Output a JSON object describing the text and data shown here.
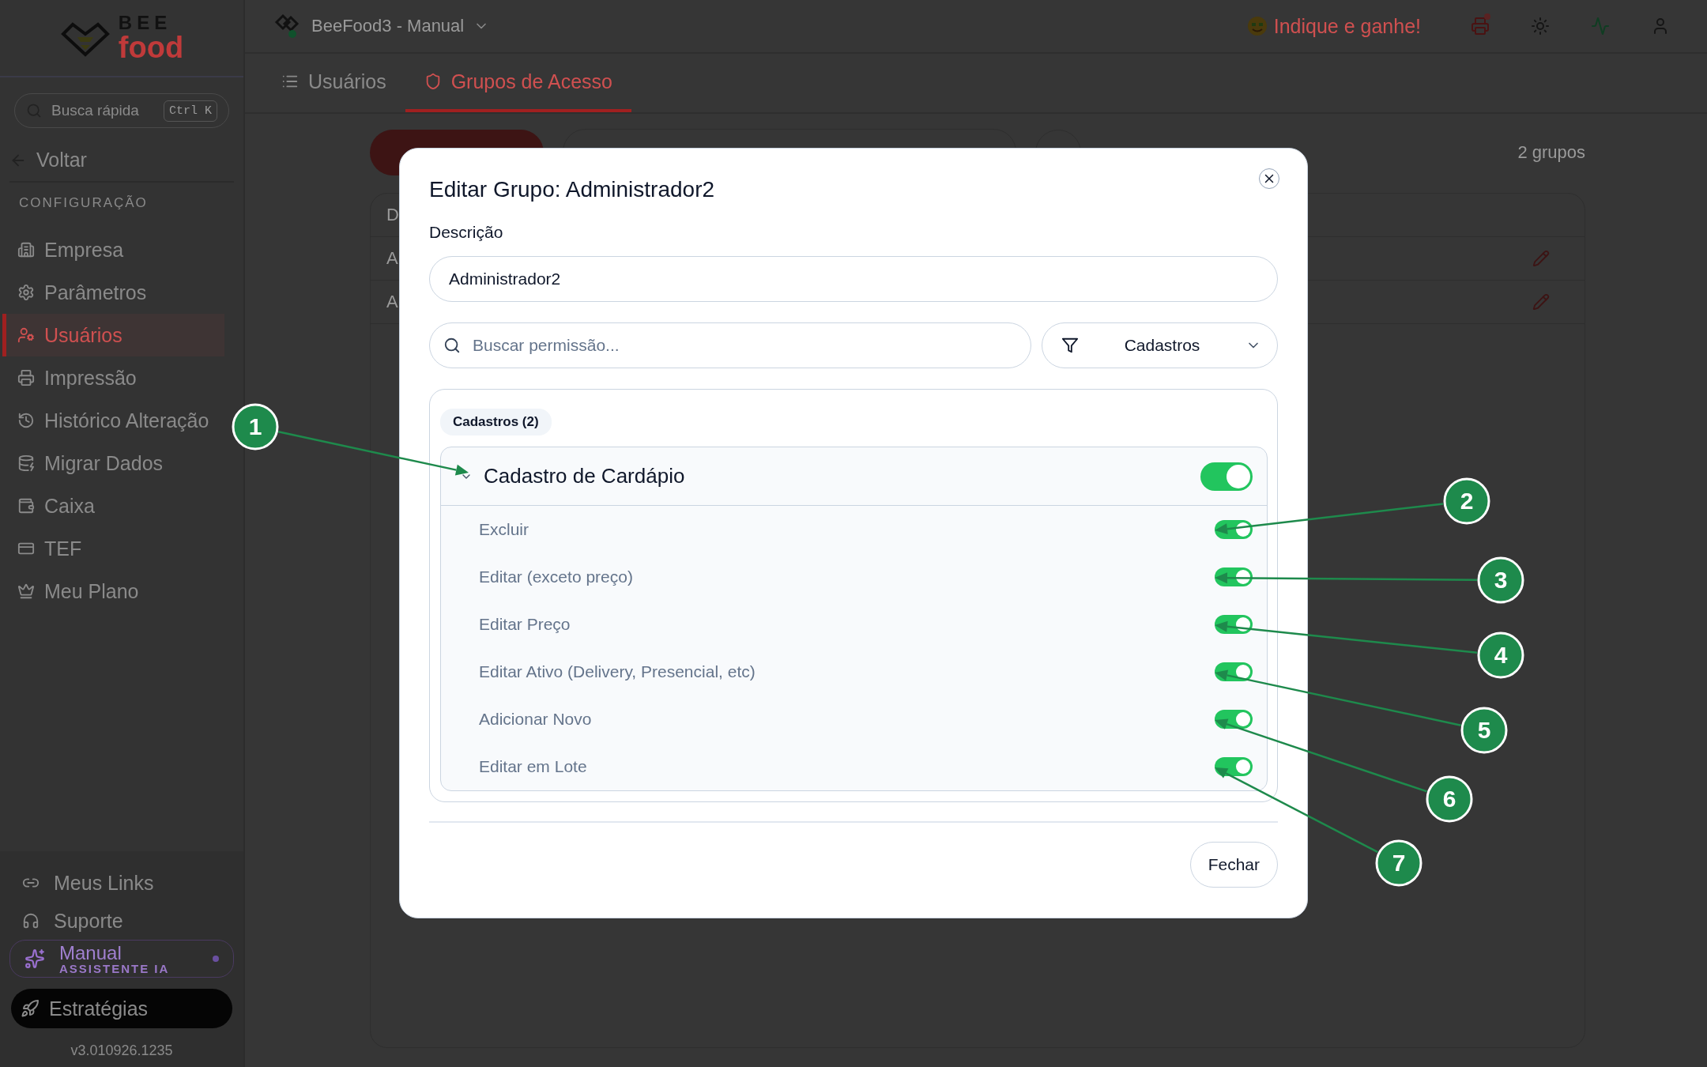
{
  "sidebar": {
    "logo_top": "BEE",
    "logo_bottom": "food",
    "quick_search": {
      "placeholder": "Busca rápida",
      "shortcut": "Ctrl K"
    },
    "back": "Voltar",
    "section": "CONFIGURAÇÃO",
    "menu": [
      {
        "label": "Empresa",
        "selected": false
      },
      {
        "label": "Parâmetros",
        "selected": false
      },
      {
        "label": "Usuários",
        "selected": true
      },
      {
        "label": "Impressão",
        "selected": false
      },
      {
        "label": "Histórico Alteração",
        "selected": false
      },
      {
        "label": "Migrar Dados",
        "selected": false
      },
      {
        "label": "Caixa",
        "selected": false
      },
      {
        "label": "TEF",
        "selected": false
      },
      {
        "label": "Meu Plano",
        "selected": false
      }
    ],
    "footer_links": [
      "Meus Links",
      "Suporte"
    ],
    "assistant": {
      "title": "Manual",
      "subtitle": "ASSISTENTE IA"
    },
    "strategies": "Estratégias",
    "version": "v3.010926.1235"
  },
  "header": {
    "workspace": "BeeFood3 - Manual",
    "referral": "Indique e ganhe!"
  },
  "tabs": [
    {
      "label": "Usuários",
      "selected": false
    },
    {
      "label": "Grupos de Acesso",
      "selected": true
    }
  ],
  "toolbar": {
    "count": "2 grupos"
  },
  "table": {
    "header": "D",
    "rows": [
      "A",
      "A"
    ]
  },
  "dialog": {
    "title": "Editar Grupo: Administrador2",
    "description_label": "Descrição",
    "description_value": "Administrador2",
    "search_placeholder": "Buscar permissão...",
    "filter": "Cadastros",
    "category": "Cadastros (2)",
    "group": {
      "name": "Cadastro de Cardápio",
      "expanded": true,
      "on": true,
      "permissions": [
        {
          "label": "Excluir",
          "on": true
        },
        {
          "label": "Editar (exceto preço)",
          "on": true
        },
        {
          "label": "Editar Preço",
          "on": true
        },
        {
          "label": "Editar Ativo (Delivery, Presencial, etc)",
          "on": true
        },
        {
          "label": "Adicionar Novo",
          "on": true
        },
        {
          "label": "Editar em Lote",
          "on": true
        }
      ]
    },
    "close_button": "Fechar"
  },
  "annotations": [
    {
      "number": "1"
    },
    {
      "number": "2"
    },
    {
      "number": "3"
    },
    {
      "number": "4"
    },
    {
      "number": "5"
    },
    {
      "number": "6"
    },
    {
      "number": "7"
    }
  ]
}
